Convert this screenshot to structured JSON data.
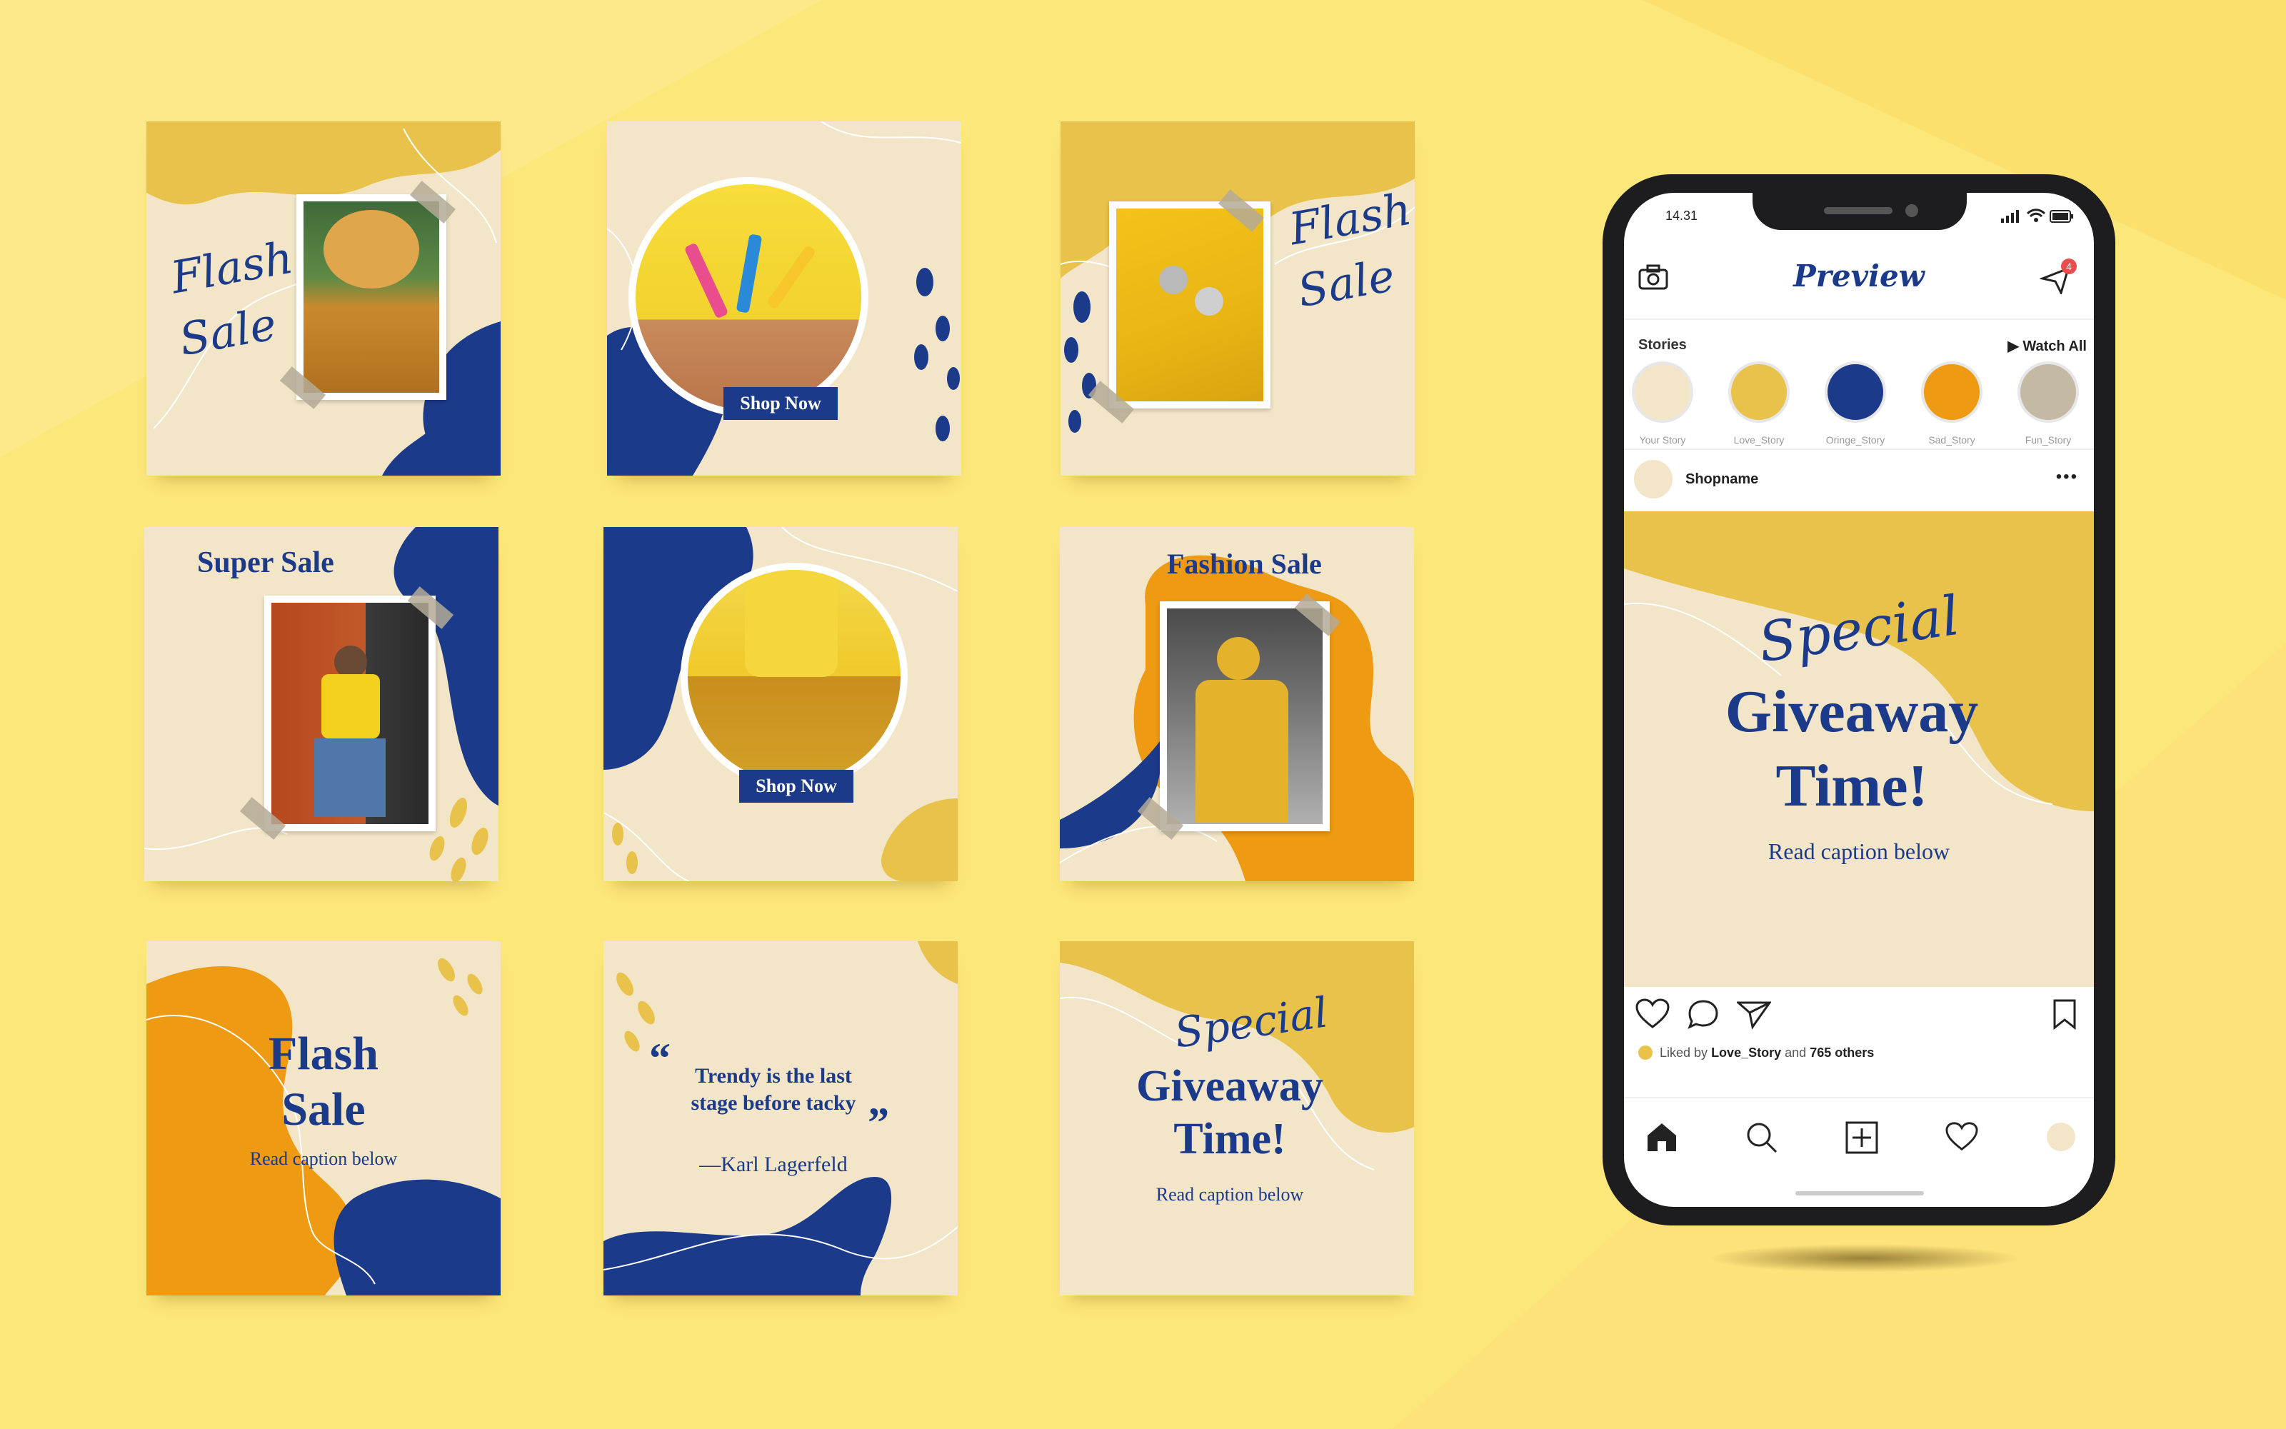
{
  "colors": {
    "background": "#fce77a",
    "navy": "#1b3a8a",
    "mustard": "#e8c24a",
    "orange": "#ee9a12",
    "cream": "#f3e6c8"
  },
  "tiles": {
    "t1": {
      "script_line1": "Flash",
      "script_line2": "Sale"
    },
    "t2": {
      "button": "Shop Now"
    },
    "t3": {
      "script_line1": "Flash",
      "script_line2": "Sale"
    },
    "t4": {
      "heading": "Super Sale"
    },
    "t5": {
      "button": "Shop Now"
    },
    "t6": {
      "heading": "Fashion Sale"
    },
    "t7": {
      "heading_line1": "Flash",
      "heading_line2": "Sale",
      "caption": "Read caption below"
    },
    "t8": {
      "open_quote": "“",
      "quote_line1": "Trendy is the last",
      "quote_line2": "stage before tacky",
      "close_quote": "”",
      "author": "—Karl Lagerfeld"
    },
    "t9": {
      "script": "Special",
      "heading_line1": "Giveaway",
      "heading_line2": "Time!",
      "caption": "Read caption below"
    }
  },
  "phone": {
    "status_time": "14.31",
    "app_title": "Preview",
    "notification_count": "4",
    "stories_label": "Stories",
    "watch_all": "▶ Watch All",
    "stories": [
      {
        "label": "Your Story",
        "color": "#f3e6c8"
      },
      {
        "label": "Love_Story",
        "color": "#e8c24a"
      },
      {
        "label": "Oringe_Story",
        "color": "#1b3a8a"
      },
      {
        "label": "Sad_Story",
        "color": "#ee9a12"
      },
      {
        "label": "Fun_Story",
        "color": "#c4baa4"
      }
    ],
    "post_account": "Shopname",
    "more": "•••",
    "post": {
      "script": "Special",
      "line1": "Giveaway",
      "line2": "Time!",
      "caption": "Read caption below"
    },
    "likes": {
      "prefix": "Liked by",
      "user": "Love_Story",
      "middle": "and",
      "count": "765 others"
    }
  }
}
